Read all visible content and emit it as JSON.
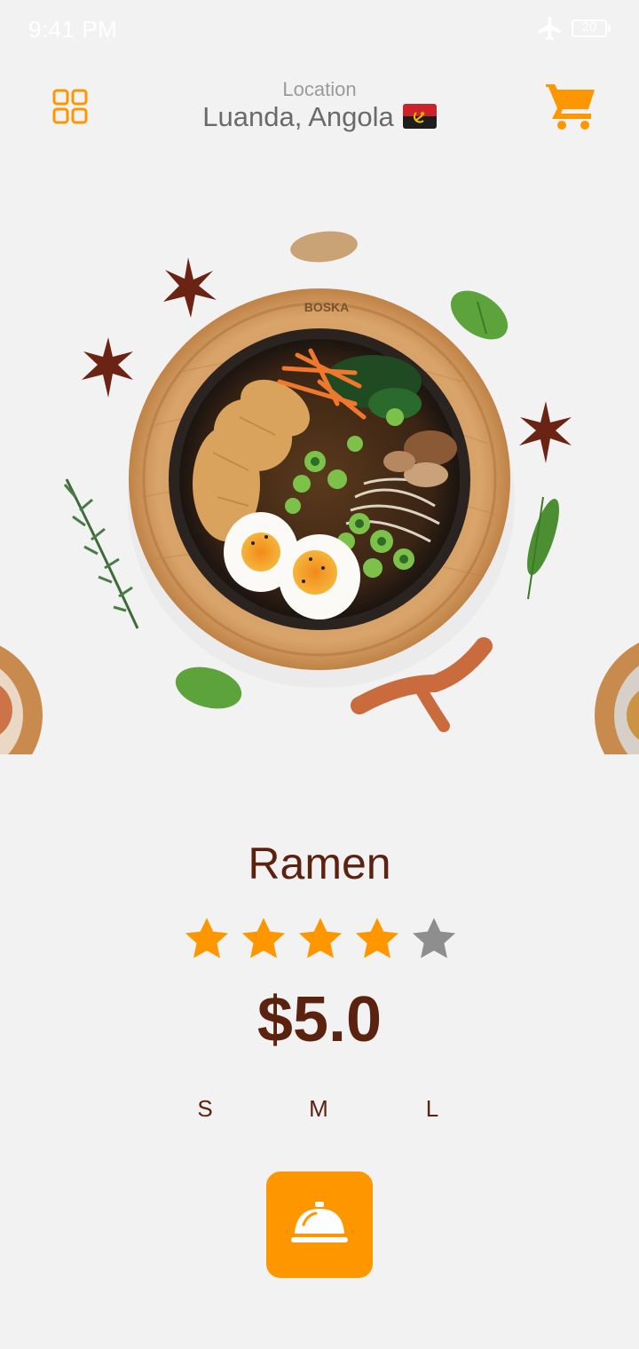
{
  "status_bar": {
    "time": "9:41 PM",
    "battery": "20"
  },
  "header": {
    "location_label": "Location",
    "location_value": "Luanda, Angola",
    "grid_icon": "grid-icon",
    "cart_icon": "shopping-cart-icon"
  },
  "hero": {
    "plate_brand": "BOSKA"
  },
  "dish": {
    "name": "Ramen",
    "rating": 4,
    "rating_max": 5,
    "price": "$5.0",
    "sizes": [
      "S",
      "M",
      "L"
    ]
  },
  "order_button": {
    "icon": "service-bell-icon"
  },
  "colors": {
    "accent": "#fe9600",
    "title": "#5c2210",
    "background": "#f2f2f2",
    "star_off": "#8e8e8e"
  }
}
